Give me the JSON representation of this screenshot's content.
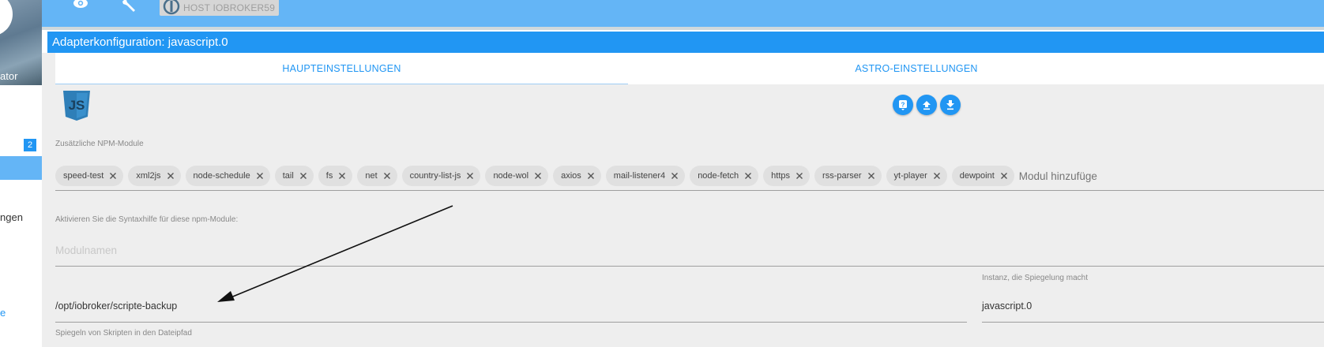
{
  "topbar": {
    "icons": [
      "eye-icon",
      "wrench-icon"
    ],
    "host_label": "HOST IOBROKER59"
  },
  "drawer": {
    "user_label": "ator",
    "badge_count": "2",
    "item_label": "ngen",
    "bottom_label": "e"
  },
  "panel": {
    "title": "Adapterkonfiguration: javascript.0"
  },
  "tabs": [
    {
      "label": "HAUPTEINSTELLUNGEN",
      "active": true
    },
    {
      "label": "ASTRO-EINSTELLUNGEN",
      "active": false
    }
  ],
  "actions": {
    "icons": [
      "help-icon",
      "upload-icon",
      "download-icon"
    ]
  },
  "npm": {
    "label": "Zusätzliche NPM-Module",
    "modules": [
      "speed-test",
      "xml2js",
      "node-schedule",
      "tail",
      "fs",
      "net",
      "country-list-js",
      "node-wol",
      "axios",
      "mail-listener4",
      "node-fetch",
      "https",
      "rss-parser",
      "yt-player",
      "dewpoint"
    ],
    "add_placeholder": "Modul hinzufüge"
  },
  "syntax": {
    "label": "Aktivieren Sie die Syntaxhilfe für diese npm-Module:",
    "placeholder": "Modulnamen"
  },
  "mirror": {
    "path_value": "/opt/iobroker/scripte-backup",
    "path_helper": "Spiegeln von Skripten in den Dateipfad",
    "instance_label": "Instanz, die Spiegelung macht",
    "instance_value": "javascript.0"
  },
  "colors": {
    "accent": "#2196f3",
    "topbar": "#64b5f6",
    "panel_bg": "#eeeeee",
    "chip_bg": "#e0e0e0"
  }
}
